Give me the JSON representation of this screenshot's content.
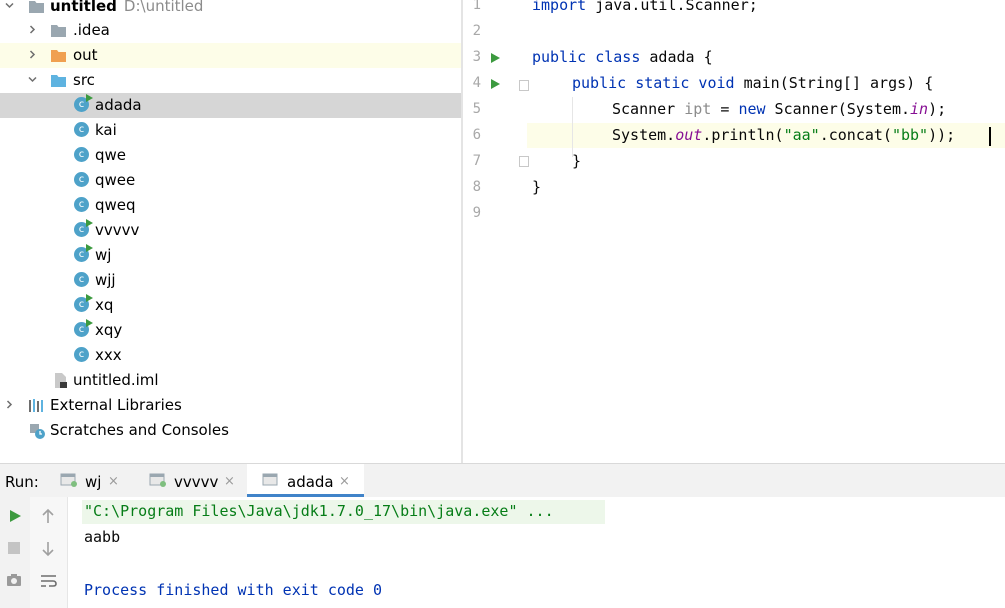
{
  "project_tree": {
    "root": {
      "name": "untitled",
      "path": "D:\\untitled"
    },
    "items": [
      {
        "label": "untitled",
        "sublabel": "D:\\untitled",
        "icon": "folder-icon",
        "bold": true,
        "expanded": true
      },
      {
        "label": ".idea",
        "icon": "folder-icon",
        "expanded": false
      },
      {
        "label": "out",
        "icon": "orange-folder-icon",
        "expanded": false,
        "highlighted": true
      },
      {
        "label": "src",
        "icon": "source-folder-icon",
        "expanded": true
      },
      {
        "label": "adada",
        "icon": "java-class-runnable-icon",
        "selected": true
      },
      {
        "label": "kai",
        "icon": "java-class-icon"
      },
      {
        "label": "qwe",
        "icon": "java-class-icon"
      },
      {
        "label": "qwee",
        "icon": "java-class-icon"
      },
      {
        "label": "qweq",
        "icon": "java-class-icon"
      },
      {
        "label": "vvvvv",
        "icon": "java-class-runnable-icon"
      },
      {
        "label": "wj",
        "icon": "java-class-runnable-icon"
      },
      {
        "label": "wjj",
        "icon": "java-class-icon"
      },
      {
        "label": "xq",
        "icon": "java-class-runnable-icon"
      },
      {
        "label": "xqy",
        "icon": "java-class-runnable-icon"
      },
      {
        "label": "xxx",
        "icon": "java-class-icon"
      },
      {
        "label": "untitled.iml",
        "icon": "module-file-icon"
      },
      {
        "label": "External Libraries",
        "icon": "libraries-icon",
        "expanded": false
      },
      {
        "label": "Scratches and Consoles",
        "icon": "scratches-icon"
      }
    ]
  },
  "editor": {
    "line_numbers": [
      "1",
      "2",
      "3",
      "4",
      "5",
      "6",
      "7",
      "8",
      "9"
    ],
    "lines": {
      "l1": {
        "kw": "import",
        "rest": " java.util.Scanner;"
      },
      "l3": {
        "kw": "public class",
        "rest": " adada {"
      },
      "l4": {
        "kw": "public static void",
        "rest": " main(String[] args) {"
      },
      "l5": {
        "a": "Scanner ",
        "var": "ipt",
        "b": " = ",
        "kw": "new",
        "c": " Scanner(System.",
        "fld": "in",
        "d": ");"
      },
      "l6": {
        "a": "System.",
        "fld": "out",
        "b": ".println(",
        "s1": "\"aa\"",
        "c": ".concat(",
        "s2": "\"bb\"",
        "d": "));"
      },
      "l7": {
        "text": "}"
      },
      "l8": {
        "text": "}"
      }
    }
  },
  "run_window": {
    "title": "Run:",
    "tabs": [
      {
        "label": "wj",
        "active": false
      },
      {
        "label": "vvvvv",
        "active": false
      },
      {
        "label": "adada",
        "active": true
      }
    ],
    "close_glyph": "×",
    "console": {
      "command": "\"C:\\Program Files\\Java\\jdk1.7.0_17\\bin\\java.exe\" ...",
      "output": "aabb",
      "exit": "Process finished with exit code 0"
    }
  },
  "colors": {
    "keyword": "#0033b3",
    "string": "#067d17",
    "field": "#871094",
    "selection": "#d6d6d6",
    "current_line": "#fdfde8",
    "run_green": "#3c9a3f",
    "tab_underline": "#4083c9",
    "console_blue": "#0033b3"
  }
}
